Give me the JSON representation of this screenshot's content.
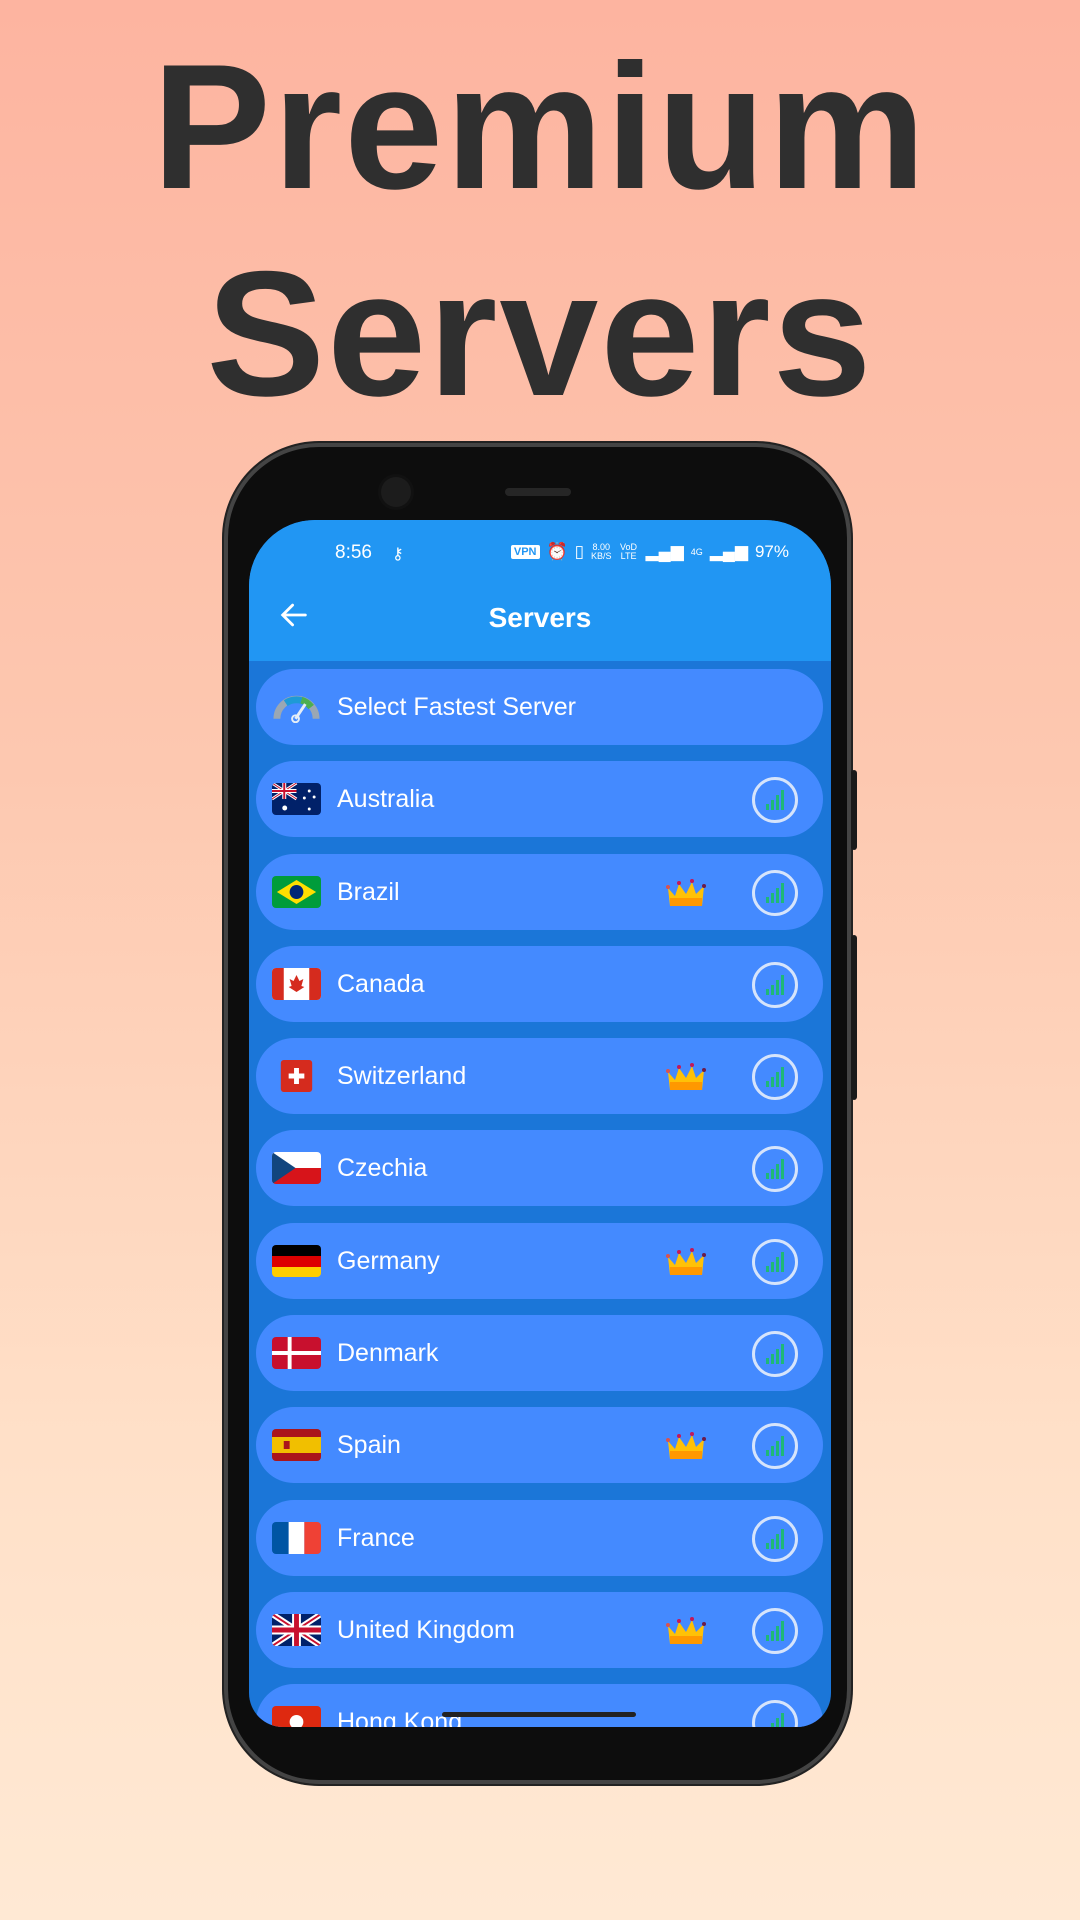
{
  "headline": {
    "line1": "Premium",
    "line2": "Servers"
  },
  "status_bar": {
    "time": "8:56",
    "vpn": "VPN",
    "speed": "8.00",
    "speed_unit": "KB/S",
    "volte": "VoD LTE",
    "network": "4G",
    "battery": "97%"
  },
  "app_bar": {
    "title": "Servers",
    "back_icon": "arrow-left-icon"
  },
  "colors": {
    "app_bar": "#2196f3",
    "list_bg": "#1b76d8",
    "row_bg": "#448aff",
    "signal": "#1fb877",
    "crown": "#ffc107"
  },
  "fastest": {
    "label": "Select Fastest Server",
    "icon": "speedometer-icon"
  },
  "servers": [
    {
      "name": "Australia",
      "flag": "au",
      "premium": false
    },
    {
      "name": "Brazil",
      "flag": "br",
      "premium": true
    },
    {
      "name": "Canada",
      "flag": "ca",
      "premium": false
    },
    {
      "name": "Switzerland",
      "flag": "ch",
      "premium": true
    },
    {
      "name": "Czechia",
      "flag": "cz",
      "premium": false
    },
    {
      "name": "Germany",
      "flag": "de",
      "premium": true
    },
    {
      "name": "Denmark",
      "flag": "dk",
      "premium": false
    },
    {
      "name": "Spain",
      "flag": "es",
      "premium": true
    },
    {
      "name": "France",
      "flag": "fr",
      "premium": false
    },
    {
      "name": "United Kingdom",
      "flag": "gb",
      "premium": true
    },
    {
      "name": "Hong Kong",
      "flag": "hk",
      "premium": false
    }
  ]
}
